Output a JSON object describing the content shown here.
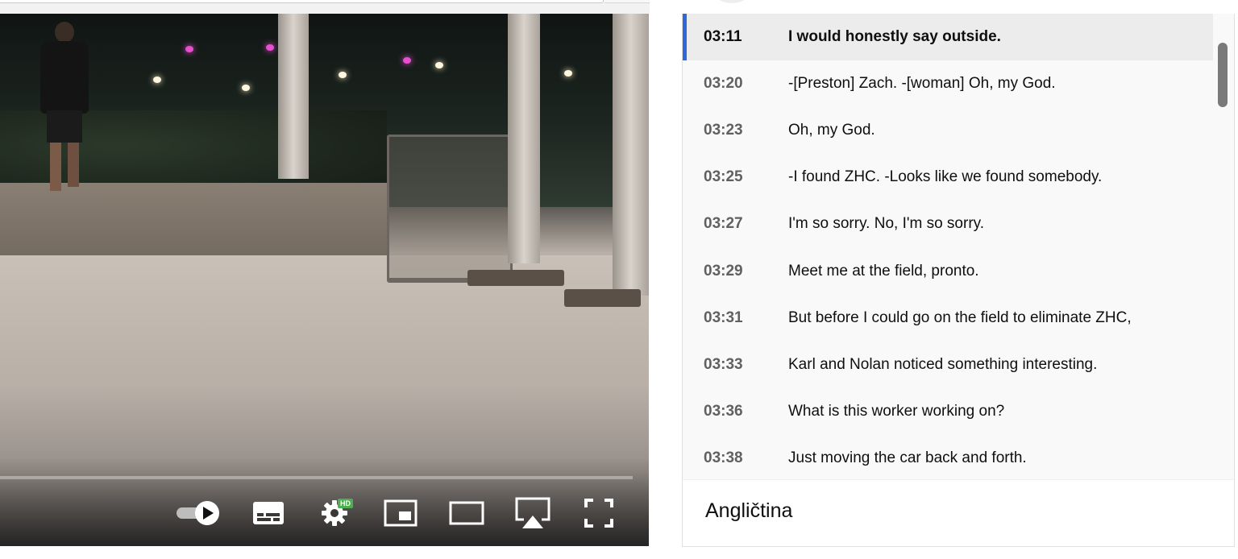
{
  "player": {
    "hd_badge": "HD",
    "controls": [
      {
        "name": "autoplay-toggle",
        "icon": "autoplay-toggle-icon"
      },
      {
        "name": "subtitles-button",
        "icon": "subtitles-icon"
      },
      {
        "name": "settings-button",
        "icon": "gear-icon"
      },
      {
        "name": "miniplayer-button",
        "icon": "miniplayer-icon"
      },
      {
        "name": "theater-mode-button",
        "icon": "theater-icon"
      },
      {
        "name": "airplay-button",
        "icon": "airplay-icon"
      },
      {
        "name": "fullscreen-button",
        "icon": "fullscreen-icon"
      }
    ]
  },
  "transcript": {
    "active_index": 0,
    "segments": [
      {
        "time": "03:11",
        "text": "I would honestly say outside."
      },
      {
        "time": "03:20",
        "text": "-[Preston] Zach. -[woman] Oh, my God."
      },
      {
        "time": "03:23",
        "text": "Oh, my God."
      },
      {
        "time": "03:25",
        "text": "-I found ZHC. -Looks like we found somebody."
      },
      {
        "time": "03:27",
        "text": "I'm so sorry. No, I'm so sorry."
      },
      {
        "time": "03:29",
        "text": "Meet me at the field, pronto."
      },
      {
        "time": "03:31",
        "text": "But before I could go on the field to eliminate ZHC,"
      },
      {
        "time": "03:33",
        "text": "Karl and Nolan noticed something interesting."
      },
      {
        "time": "03:36",
        "text": "What is this worker working on?"
      },
      {
        "time": "03:38",
        "text": "Just moving the car back and forth."
      }
    ],
    "language": "Angličtina"
  },
  "colors": {
    "accent": "#3167d6",
    "hd_badge": "#4caf50"
  }
}
